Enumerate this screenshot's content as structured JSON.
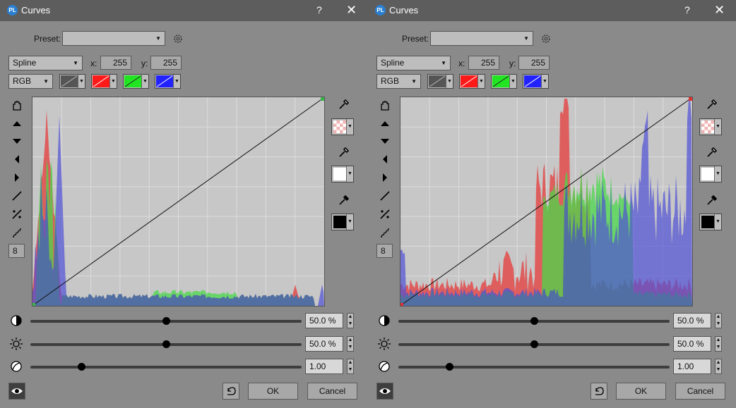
{
  "dialogs": [
    {
      "title": "Curves",
      "help_label": "?",
      "close_label": "✕",
      "app_icon_text": "PL",
      "preset_label": "Preset:",
      "preset_value": "",
      "mode_value": "Spline",
      "x_label": "x:",
      "x_value": "255",
      "y_label": "y:",
      "y_value": "255",
      "channel_value": "RGB",
      "zoom_value": "8",
      "contrast_value": "50.0 %",
      "brightness_value": "50.0 %",
      "gamma_value": "1.00",
      "contrast_level": 0.5,
      "brightness_level": 0.5,
      "gamma_level": 0.19,
      "ok_label": "OK",
      "cancel_label": "Cancel",
      "endpoint_color": "#39b54a",
      "histogram_variant": "dark"
    },
    {
      "title": "Curves",
      "help_label": "?",
      "close_label": "✕",
      "app_icon_text": "PL",
      "preset_label": "Preset:",
      "preset_value": "",
      "mode_value": "Spline",
      "x_label": "x:",
      "x_value": "255",
      "y_label": "y:",
      "y_value": "255",
      "channel_value": "RGB",
      "zoom_value": "8",
      "contrast_value": "50.0 %",
      "brightness_value": "50.0 %",
      "gamma_value": "1.00",
      "contrast_level": 0.5,
      "brightness_level": 0.5,
      "gamma_level": 0.19,
      "ok_label": "OK",
      "cancel_label": "Cancel",
      "endpoint_color": "#e03030",
      "histogram_variant": "spread"
    }
  ],
  "colors": {
    "red": "#ff1a1a",
    "green": "#22e522",
    "blue": "#2222ff",
    "histogram_red": "#e24b4b",
    "histogram_green": "#4ad84a",
    "histogram_blue": "#5050d6"
  }
}
